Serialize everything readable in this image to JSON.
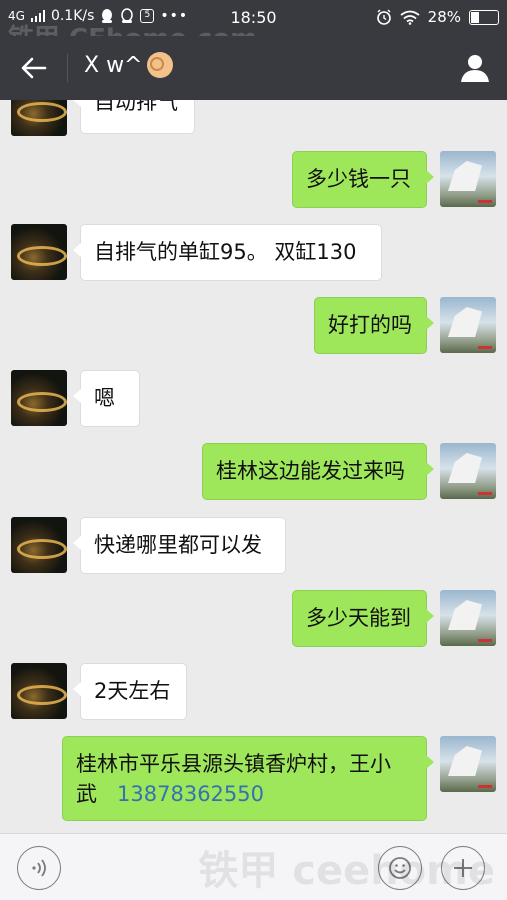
{
  "status_bar": {
    "network": "4G",
    "speed": "0.1K/s",
    "mini_icon": "5",
    "dots": "•••",
    "time": "18:50",
    "battery": "28%",
    "battery_level": 0.28,
    "icons": [
      "signal-icon",
      "qq-icon",
      "alarm-icon",
      "wifi-icon",
      "battery-icon"
    ]
  },
  "watermark": {
    "top": "铁甲 CEhome.com",
    "bottom": "铁甲 ceehome"
  },
  "nav": {
    "title": "X w^",
    "emoji": "ok-hand-emoji",
    "icons": [
      "back-arrow-icon",
      "profile-icon"
    ]
  },
  "messages": [
    {
      "side": "in",
      "text": "自动排气"
    },
    {
      "side": "out",
      "text": "多少钱一只"
    },
    {
      "side": "in",
      "text": "自排气的单缸95。 双缸130"
    },
    {
      "side": "out",
      "text": "好打的吗"
    },
    {
      "side": "in",
      "text": "嗯"
    },
    {
      "side": "out",
      "text": "桂林这边能发过来吗"
    },
    {
      "side": "in",
      "text": "快递哪里都可以发"
    },
    {
      "side": "out",
      "text": "多少天能到"
    },
    {
      "side": "in",
      "text": "2天左右"
    },
    {
      "side": "out",
      "text_line1": "桂林市平乐县源头镇香炉村，王小",
      "text_line2_prefix": "武",
      "phone": "13878362550"
    }
  ],
  "input_bar": {
    "icons": [
      "voice-icon",
      "emoji-icon",
      "plus-icon"
    ]
  },
  "colors": {
    "header_bg": "#393a3f",
    "chat_bg": "#ebebeb",
    "bubble_out": "#9ee65a",
    "bubble_in": "#ffffff",
    "link": "#3573b0"
  }
}
